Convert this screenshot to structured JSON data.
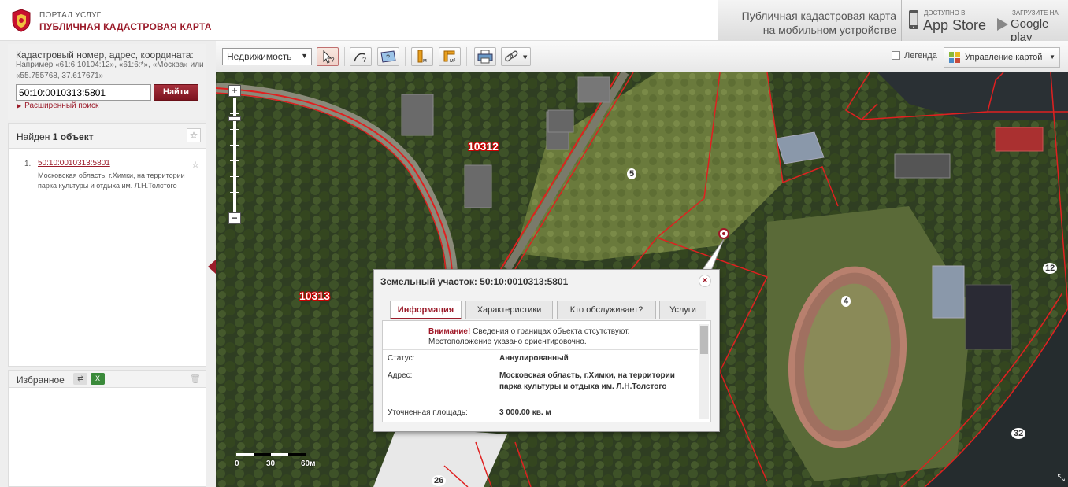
{
  "header": {
    "brand_small": "ПОРТАЛ УСЛУГ",
    "brand_big": "ПУБЛИЧНАЯ КАДАСТРОВАЯ КАРТА",
    "mobile_line1": "Публичная кадастровая карта",
    "mobile_line2": "на мобильном устройстве",
    "appstore_small": "Доступно в",
    "appstore_big": "App Store",
    "gplay_small": "Загрузите на",
    "gplay_big": "Google play"
  },
  "search": {
    "title": "Кадастровый номер, адрес, координата:",
    "hint": "Например «61:6:10104:12», «61:6:*», «Москва» или «55.755768, 37.617671»",
    "value": "50:10:0010313:5801",
    "button": "Найти",
    "advanced": "Расширенный поиск"
  },
  "results": {
    "found_prefix": "Найден",
    "found_count": "1 объект",
    "items": [
      {
        "num": "1.",
        "link": "50:10:0010313:5801",
        "address": "Московская область, г.Химки, на территории парка культуры и отдыха им. Л.Н.Толстого"
      }
    ]
  },
  "favorites": {
    "title": "Избранное"
  },
  "toolbar": {
    "select_value": "Недвижимость",
    "legend": "Легенда",
    "map_control": "Управление картой"
  },
  "map": {
    "labels": {
      "block1": "10312",
      "block2": "10313",
      "n5": "5",
      "n4": "4",
      "n32": "32",
      "n26": "26",
      "n12": "12"
    },
    "scale": {
      "l0": "0",
      "l30": "30",
      "l60": "60м"
    }
  },
  "popup": {
    "title": "Земельный участок: 50:10:0010313:5801",
    "tabs": [
      "Информация",
      "Характеристики",
      "Кто обслуживает?",
      "Услуги"
    ],
    "warning_bold": "Внимание!",
    "warning_text": " Сведения о границах объекта отсутствуют. Местоположение указано ориентировочно.",
    "rows": [
      {
        "key": "Статус:",
        "value": "Аннулированный"
      },
      {
        "key": "Адрес:",
        "value": "Московская область, г.Химки, на территории парка культуры и отдыха им. Л.Н.Толстого"
      },
      {
        "key": "Уточненная площадь:",
        "value": "3 000.00 кв. м"
      }
    ]
  },
  "colors": {
    "accent": "#9b1b2a",
    "boundary": "#e02020"
  }
}
